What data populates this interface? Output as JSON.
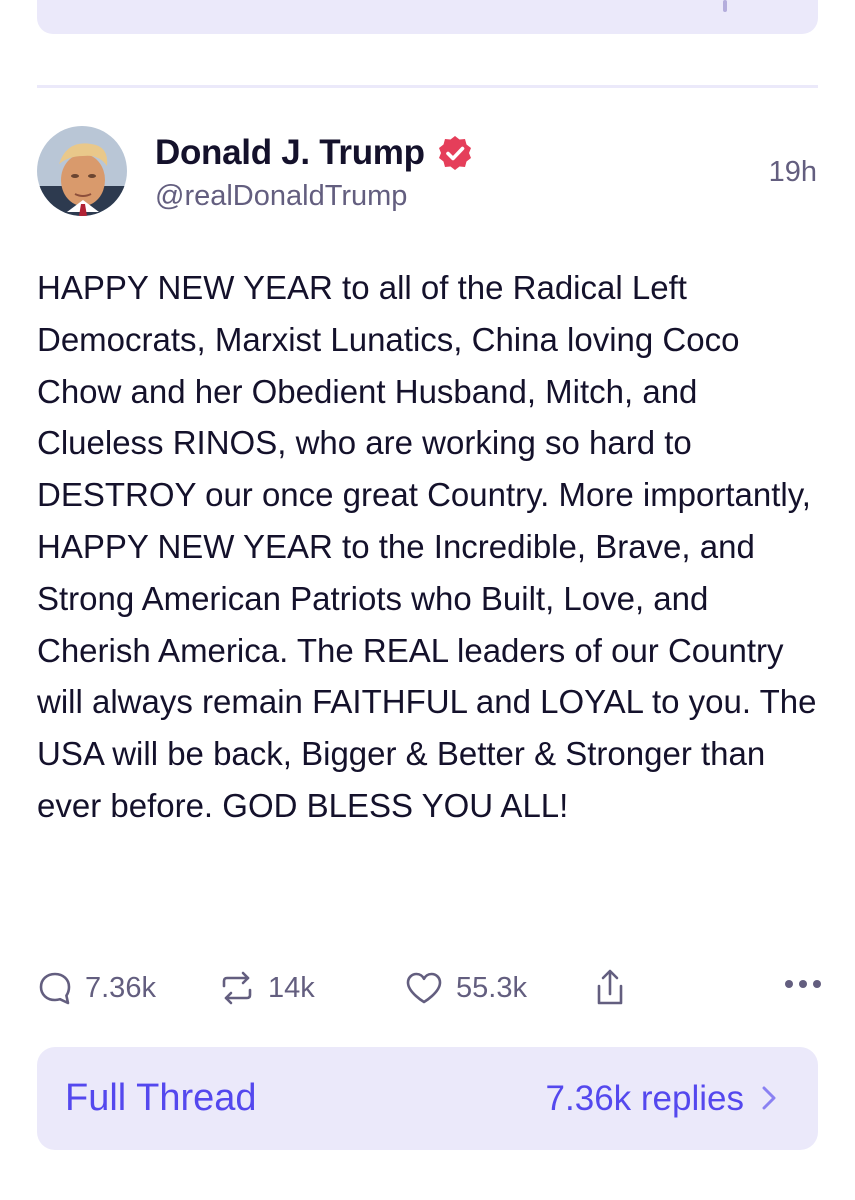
{
  "post": {
    "author_name": "Donald J. Trump",
    "handle": "@realDonaldTrump",
    "timestamp": "19h",
    "text": "HAPPY NEW YEAR to all of the Radical Left Democrats, Marxist Lunatics, China loving Coco Chow and her Obedient Husband, Mitch, and Clueless RINOS, who are working so hard to DESTROY our once great Country. More importantly, HAPPY NEW YEAR to the Incredible, Brave, and Strong American Patriots who Built, Love, and Cherish America. The REAL leaders of our Country will always remain FAITHFUL and LOYAL to you. The USA will be back, Bigger & Better & Stronger than ever before. GOD BLESS YOU ALL!",
    "verified": true
  },
  "actions": {
    "replies": "7.36k",
    "reblogs": "14k",
    "likes": "55.3k",
    "icons": [
      "reply-icon",
      "reblog-icon",
      "like-icon",
      "share-icon",
      "more-icon"
    ]
  },
  "thread": {
    "label": "Full Thread",
    "replies_label": "7.36k replies"
  },
  "colors": {
    "accent": "#5448ee",
    "verified_badge": "#e53e5a",
    "card_background": "#ebe9fa",
    "muted_text": "#635e7f"
  }
}
